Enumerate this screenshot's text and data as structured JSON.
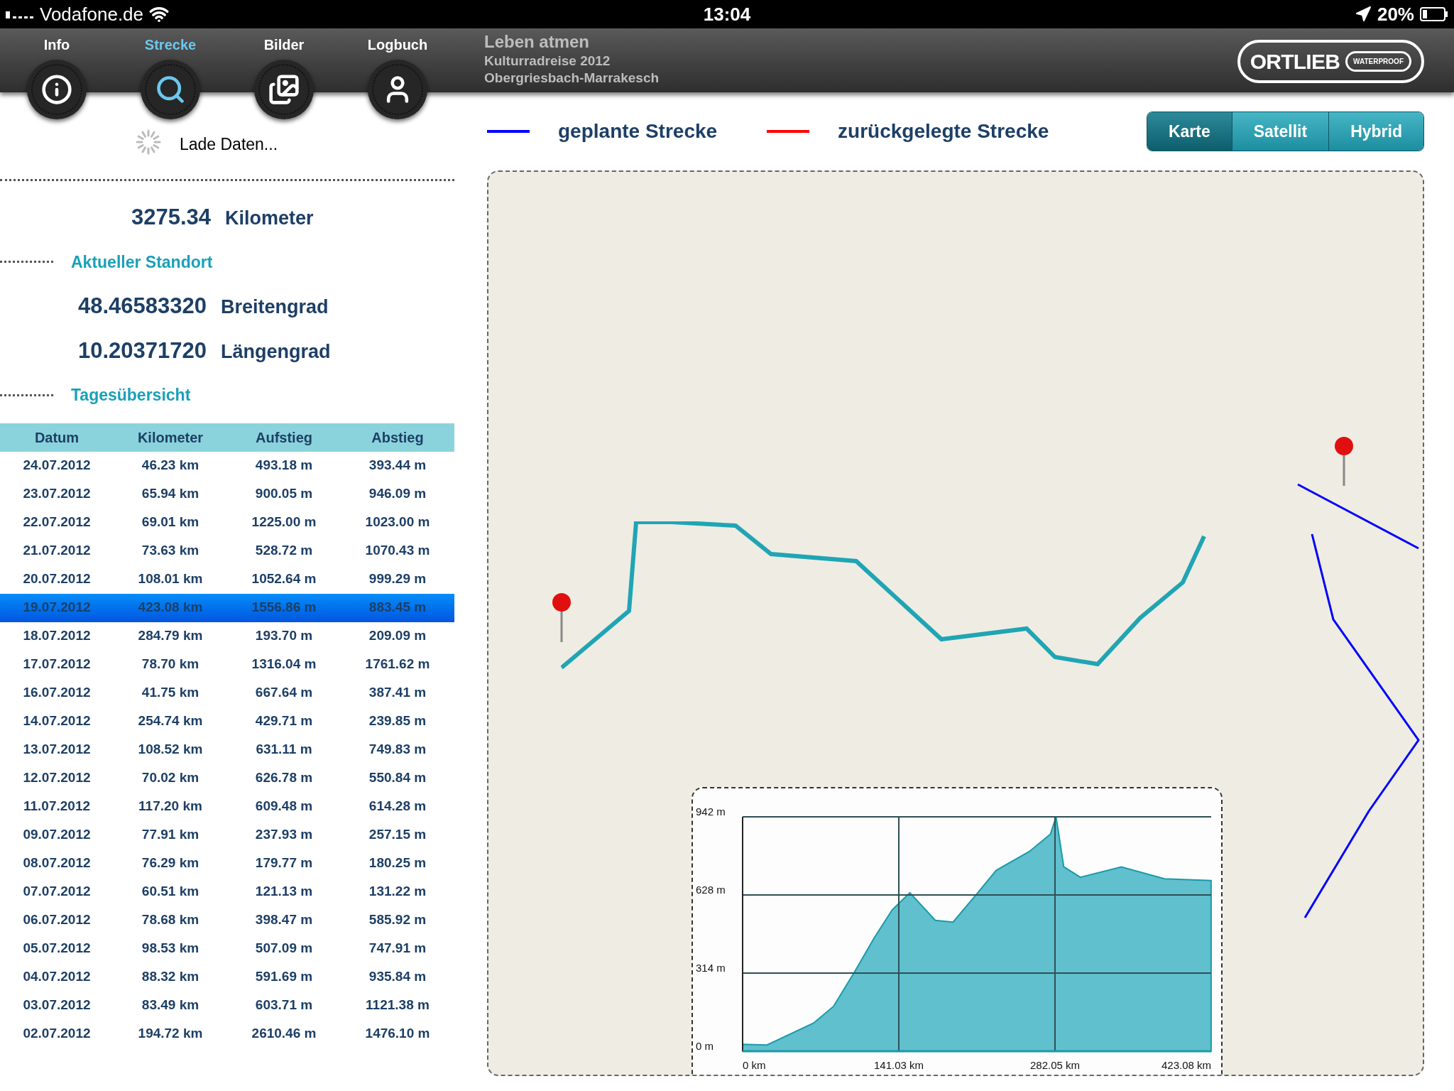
{
  "status_bar": {
    "carrier": "Vodafone.de",
    "time": "13:04",
    "battery": "20%"
  },
  "nav": {
    "tabs": [
      {
        "label": "Info",
        "selected": false
      },
      {
        "label": "Strecke",
        "selected": true
      },
      {
        "label": "Bilder",
        "selected": false
      },
      {
        "label": "Logbuch",
        "selected": false
      }
    ],
    "title": "Leben atmen",
    "subtitle": "Kulturradreise 2012",
    "route": "Obergriesbach-Marrakesch",
    "logo": {
      "brand": "ORTLIEB",
      "tag": "WATERPROOF"
    }
  },
  "loading": "Lade Daten...",
  "total": {
    "value": "3275.34",
    "unit": "Kilometer"
  },
  "location": {
    "heading": "Aktueller Standort",
    "lat": "48.46583320",
    "lat_label": "Breitengrad",
    "lon": "10.20371720",
    "lon_label": "Längengrad"
  },
  "daily": {
    "heading": "Tagesübersicht",
    "columns": [
      "Datum",
      "Kilometer",
      "Aufstieg",
      "Abstieg"
    ],
    "rows": [
      {
        "cells": [
          "24.07.2012",
          "46.23 km",
          "493.18 m",
          "393.44 m"
        ],
        "selected": false
      },
      {
        "cells": [
          "23.07.2012",
          "65.94 km",
          "900.05 m",
          "946.09 m"
        ],
        "selected": false
      },
      {
        "cells": [
          "22.07.2012",
          "69.01 km",
          "1225.00 m",
          "1023.00 m"
        ],
        "selected": false
      },
      {
        "cells": [
          "21.07.2012",
          "73.63 km",
          "528.72 m",
          "1070.43 m"
        ],
        "selected": false
      },
      {
        "cells": [
          "20.07.2012",
          "108.01 km",
          "1052.64 m",
          "999.29 m"
        ],
        "selected": false
      },
      {
        "cells": [
          "19.07.2012",
          "423.08 km",
          "1556.86 m",
          "883.45 m"
        ],
        "selected": true
      },
      {
        "cells": [
          "18.07.2012",
          "284.79 km",
          "193.70 m",
          "209.09 m"
        ],
        "selected": false
      },
      {
        "cells": [
          "17.07.2012",
          "78.70 km",
          "1316.04 m",
          "1761.62 m"
        ],
        "selected": false
      },
      {
        "cells": [
          "16.07.2012",
          "41.75 km",
          "667.64 m",
          "387.41 m"
        ],
        "selected": false
      },
      {
        "cells": [
          "14.07.2012",
          "254.74 km",
          "429.71 m",
          "239.85 m"
        ],
        "selected": false
      },
      {
        "cells": [
          "13.07.2012",
          "108.52 km",
          "631.11 m",
          "749.83 m"
        ],
        "selected": false
      },
      {
        "cells": [
          "12.07.2012",
          "70.02 km",
          "626.78 m",
          "550.84 m"
        ],
        "selected": false
      },
      {
        "cells": [
          "11.07.2012",
          "117.20 km",
          "609.48 m",
          "614.28 m"
        ],
        "selected": false
      },
      {
        "cells": [
          "09.07.2012",
          "77.91 km",
          "237.93 m",
          "257.15 m"
        ],
        "selected": false
      },
      {
        "cells": [
          "08.07.2012",
          "76.29 km",
          "179.77 m",
          "180.25 m"
        ],
        "selected": false
      },
      {
        "cells": [
          "07.07.2012",
          "60.51 km",
          "121.13 m",
          "131.22 m"
        ],
        "selected": false
      },
      {
        "cells": [
          "06.07.2012",
          "78.68 km",
          "398.47 m",
          "585.92 m"
        ],
        "selected": false
      },
      {
        "cells": [
          "05.07.2012",
          "98.53 km",
          "507.09 m",
          "747.91 m"
        ],
        "selected": false
      },
      {
        "cells": [
          "04.07.2012",
          "88.32 km",
          "591.69 m",
          "935.84 m"
        ],
        "selected": false
      },
      {
        "cells": [
          "03.07.2012",
          "83.49 km",
          "603.71 m",
          "1121.38 m"
        ],
        "selected": false
      },
      {
        "cells": [
          "02.07.2012",
          "194.72 km",
          "2610.46 m",
          "1476.10 m"
        ],
        "selected": false
      }
    ]
  },
  "legend": [
    {
      "label": "geplante Strecke",
      "color": "#0000ff"
    },
    {
      "label": "zurückgelegte Strecke",
      "color": "#ff0000"
    }
  ],
  "map_types": [
    {
      "label": "Karte",
      "selected": true
    },
    {
      "label": "Satellit",
      "selected": false
    },
    {
      "label": "Hybrid",
      "selected": false
    }
  ],
  "elevation": {
    "chart_data": {
      "type": "area",
      "x": [
        0,
        22,
        64,
        82,
        101,
        119,
        135,
        151,
        174,
        190,
        211,
        229,
        259,
        278,
        283,
        290,
        305,
        342,
        381,
        423
      ],
      "grid": true,
      "series": [
        {
          "color": "#45b5c4",
          "values": [
            28,
            25,
            113,
            180,
            318,
            457,
            568,
            637,
            526,
            519,
            630,
            727,
            803,
            873,
            942,
            741,
            699,
            741,
            693,
            686
          ]
        }
      ],
      "xlim": [
        0,
        423.08
      ],
      "ylim": [
        0,
        942
      ],
      "xticks": [
        {
          "value": 0,
          "label": "0 km"
        },
        {
          "value": 141.03,
          "label": "141.03 km"
        },
        {
          "value": 282.05,
          "label": "282.05 km"
        },
        {
          "value": 423.08,
          "label": "423.08 km"
        }
      ],
      "yticks": [
        {
          "value": 0,
          "label": "0 m"
        },
        {
          "value": 314,
          "label": "314 m"
        },
        {
          "value": 628,
          "label": "628 m"
        },
        {
          "value": 942,
          "label": "942 m"
        }
      ]
    }
  }
}
